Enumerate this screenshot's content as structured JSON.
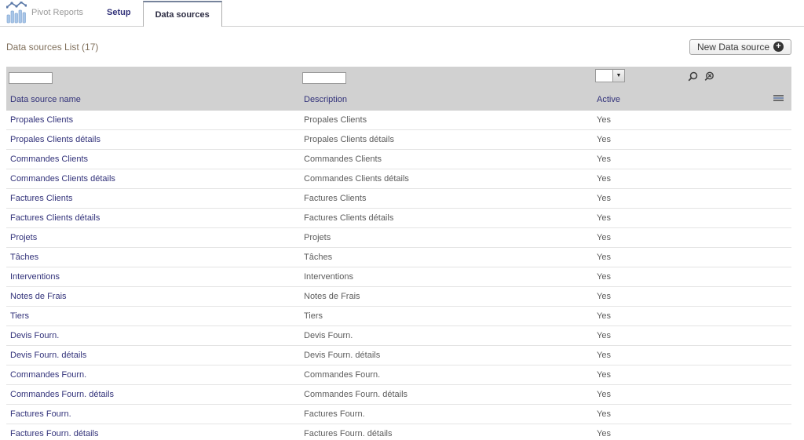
{
  "app": {
    "name": "Pivot Reports"
  },
  "tabs": {
    "setup": "Setup",
    "data_sources": "Data sources"
  },
  "page": {
    "title": "Data sources List (17)",
    "new_button_label": "New Data source"
  },
  "filters": {
    "name_value": "",
    "description_value": "",
    "active_value": ""
  },
  "icons": {
    "search": "search-icon",
    "clear_search": "clear-search-icon",
    "plus": "plus-circle-icon",
    "columns": "column-select-icon",
    "logo": "bar-chart-logo"
  },
  "colors": {
    "link": "#32327a",
    "title": "#80705c",
    "table_header_bg": "#d1d1d1",
    "row_border": "#e4e4e4",
    "text_muted": "#5c5c5c"
  },
  "table": {
    "columns": {
      "name": "Data source name",
      "description": "Description",
      "active": "Active"
    },
    "rows": [
      {
        "name": "Propales Clients",
        "description": "Propales Clients",
        "active": "Yes"
      },
      {
        "name": "Propales Clients détails",
        "description": "Propales Clients détails",
        "active": "Yes"
      },
      {
        "name": "Commandes Clients",
        "description": "Commandes Clients",
        "active": "Yes"
      },
      {
        "name": "Commandes Clients détails",
        "description": "Commandes Clients détails",
        "active": "Yes"
      },
      {
        "name": "Factures Clients",
        "description": "Factures Clients",
        "active": "Yes"
      },
      {
        "name": "Factures Clients détails",
        "description": "Factures Clients détails",
        "active": "Yes"
      },
      {
        "name": "Projets",
        "description": "Projets",
        "active": "Yes"
      },
      {
        "name": "Tâches",
        "description": "Tâches",
        "active": "Yes"
      },
      {
        "name": "Interventions",
        "description": "Interventions",
        "active": "Yes"
      },
      {
        "name": "Notes de Frais",
        "description": "Notes de Frais",
        "active": "Yes"
      },
      {
        "name": "Tiers",
        "description": "Tiers",
        "active": "Yes"
      },
      {
        "name": "Devis Fourn.",
        "description": "Devis Fourn.",
        "active": "Yes"
      },
      {
        "name": "Devis Fourn. détails",
        "description": "Devis Fourn. détails",
        "active": "Yes"
      },
      {
        "name": "Commandes Fourn.",
        "description": "Commandes Fourn.",
        "active": "Yes"
      },
      {
        "name": "Commandes Fourn. détails",
        "description": "Commandes Fourn. détails",
        "active": "Yes"
      },
      {
        "name": "Factures Fourn.",
        "description": "Factures Fourn.",
        "active": "Yes"
      },
      {
        "name": "Factures Fourn. détails",
        "description": "Factures Fourn. détails",
        "active": "Yes"
      }
    ]
  }
}
